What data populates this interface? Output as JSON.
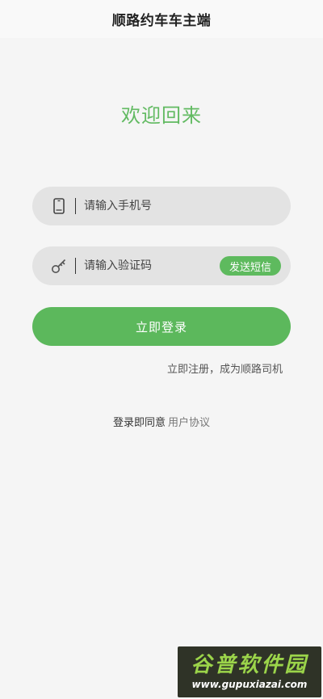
{
  "header": {
    "title": "顺路约车车主端"
  },
  "welcome": "欢迎回来",
  "phone_field": {
    "placeholder": "请输入手机号",
    "value": "",
    "icon": "phone-icon"
  },
  "code_field": {
    "placeholder": "请输入验证码",
    "value": "",
    "icon": "key-icon",
    "send_sms_label": "发送短信"
  },
  "login_button": "立即登录",
  "register_link": "立即注册，成为顺路司机",
  "agreement": {
    "prefix": "登录即同意",
    "link": "用户协议"
  },
  "watermark": {
    "brand": "谷普软件园",
    "url": "www.gupuxiazai.com"
  },
  "colors": {
    "accent": "#5cb85c",
    "background": "#f5f5f5",
    "field_background": "#e3e3e3"
  }
}
